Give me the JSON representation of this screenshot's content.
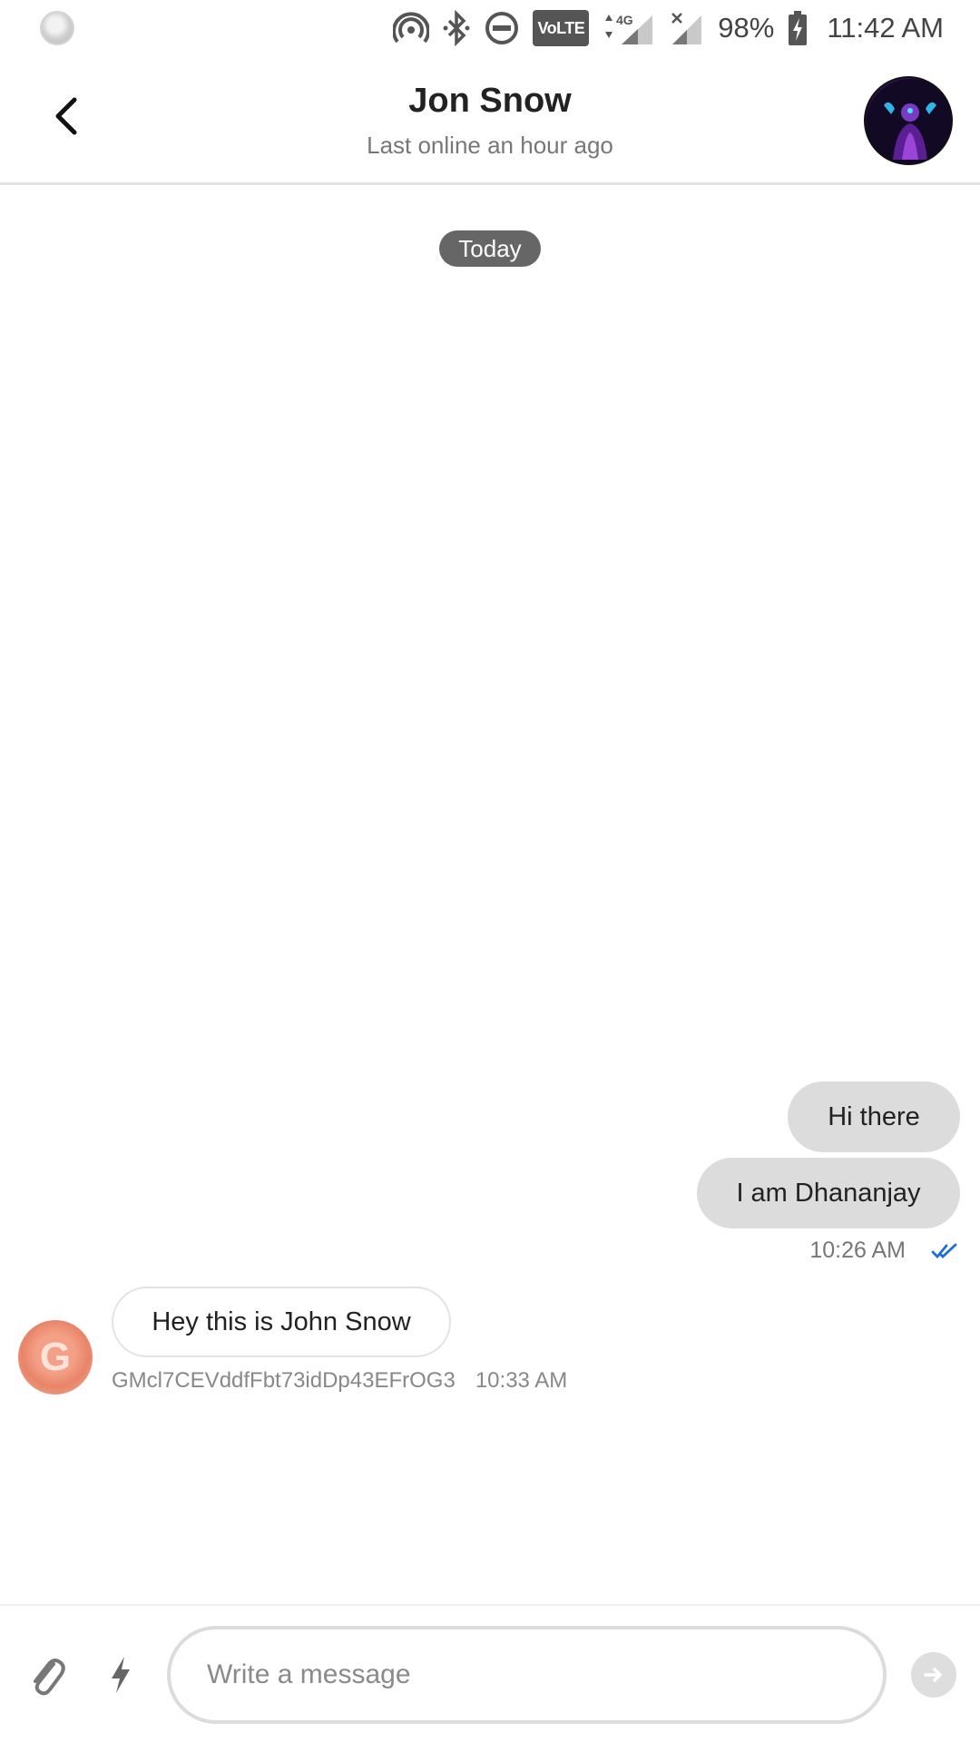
{
  "status_bar": {
    "battery": "98%",
    "time": "11:42 AM",
    "network": "4G",
    "volte": "VoLTE",
    "icons": [
      "hotspot-icon",
      "bluetooth-icon",
      "dnd-icon",
      "volte-icon",
      "signal-icon",
      "signal-no-service-icon",
      "battery-charging-icon"
    ]
  },
  "header": {
    "contact_name": "Jon Snow",
    "contact_status": "Last online an hour ago",
    "back_icon": "chevron-left-icon"
  },
  "conversation": {
    "date_label": "Today",
    "outgoing": [
      {
        "text": "Hi there"
      },
      {
        "text": "I am Dhananjay"
      }
    ],
    "outgoing_time": "10:26 AM",
    "outgoing_status": "read",
    "incoming": {
      "avatar_letter": "G",
      "text": "Hey this is John Snow",
      "sender_id": "GMcl7CEVddfFbt73idDp43EFrOG3",
      "time": "10:33 AM"
    }
  },
  "composer": {
    "placeholder": "Write a message",
    "value": ""
  },
  "colors": {
    "outgoing_bubble": "#dcdcdc",
    "read_tick": "#1e6fd9",
    "date_chip": "#666666"
  }
}
